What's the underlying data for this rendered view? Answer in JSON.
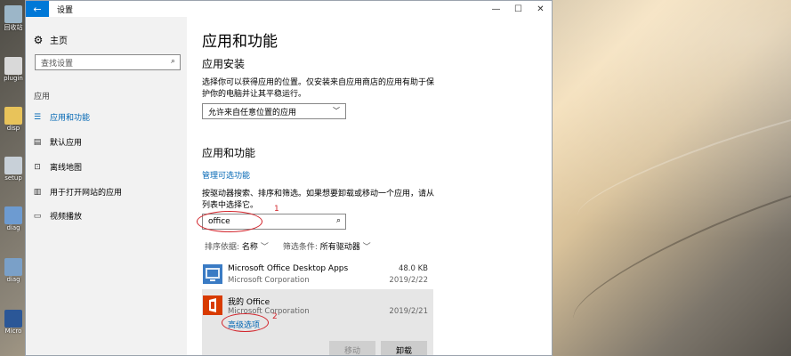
{
  "desktop": {
    "icons": [
      {
        "name": "recycle-bin-icon",
        "label": "回收站",
        "color": "#9cb6c8"
      },
      {
        "name": "plugin-icon",
        "label": "plugin",
        "color": "#d9d9d9"
      },
      {
        "name": "folder-icon",
        "label": "disp",
        "color": "#e8c35a"
      },
      {
        "name": "setup-icon",
        "label": "setup",
        "color": "#c8d0d8"
      },
      {
        "name": "app-icon",
        "label": "diag",
        "color": "#6d9bd1"
      },
      {
        "name": "app-icon-2",
        "label": "diag",
        "color": "#7aa0c8"
      },
      {
        "name": "word-icon",
        "label": "Micro",
        "color": "#2b5797"
      }
    ]
  },
  "window": {
    "title": "设置",
    "back_glyph": "←",
    "minimize_glyph": "—",
    "maximize_glyph": "☐",
    "close_glyph": "✕"
  },
  "nav": {
    "home_label": "主页",
    "search_placeholder": "查找设置",
    "section_label": "应用",
    "items": [
      {
        "label": "应用和功能",
        "icon": "☰",
        "active": true
      },
      {
        "label": "默认应用",
        "icon": "▤",
        "active": false
      },
      {
        "label": "离线地图",
        "icon": "⊡",
        "active": false
      },
      {
        "label": "用于打开网站的应用",
        "icon": "▥",
        "active": false
      },
      {
        "label": "视频播放",
        "icon": "▭",
        "active": false
      }
    ]
  },
  "content": {
    "page_title": "应用和功能",
    "install_heading": "应用安装",
    "install_desc": "选择你可以获得应用的位置。仅安装来自应用商店的应用有助于保护你的电脑并让其平稳运行。",
    "install_option": "允许来自任意位置的应用",
    "apps_heading": "应用和功能",
    "optional_features_link": "管理可选功能",
    "search_desc": "按驱动器搜索、排序和筛选。如果想要卸载或移动一个应用，请从列表中选择它。",
    "search_value": "office",
    "sort_label": "排序依据:",
    "sort_value": "名称",
    "filter_label": "筛选条件:",
    "filter_value": "所有驱动器",
    "apps": [
      {
        "name": "Microsoft Office Desktop Apps",
        "publisher": "Microsoft Corporation",
        "size": "48.0 KB",
        "date": "2019/2/22"
      },
      {
        "name": "我的 Office",
        "publisher": "Microsoft Corporation",
        "size": "",
        "date": "2019/2/21"
      }
    ],
    "advanced_options": "高级选项",
    "move_button": "移动",
    "uninstall_button": "卸载"
  },
  "annotations": {
    "mark1": "1",
    "mark2": "2",
    "color": "#d2232a"
  }
}
